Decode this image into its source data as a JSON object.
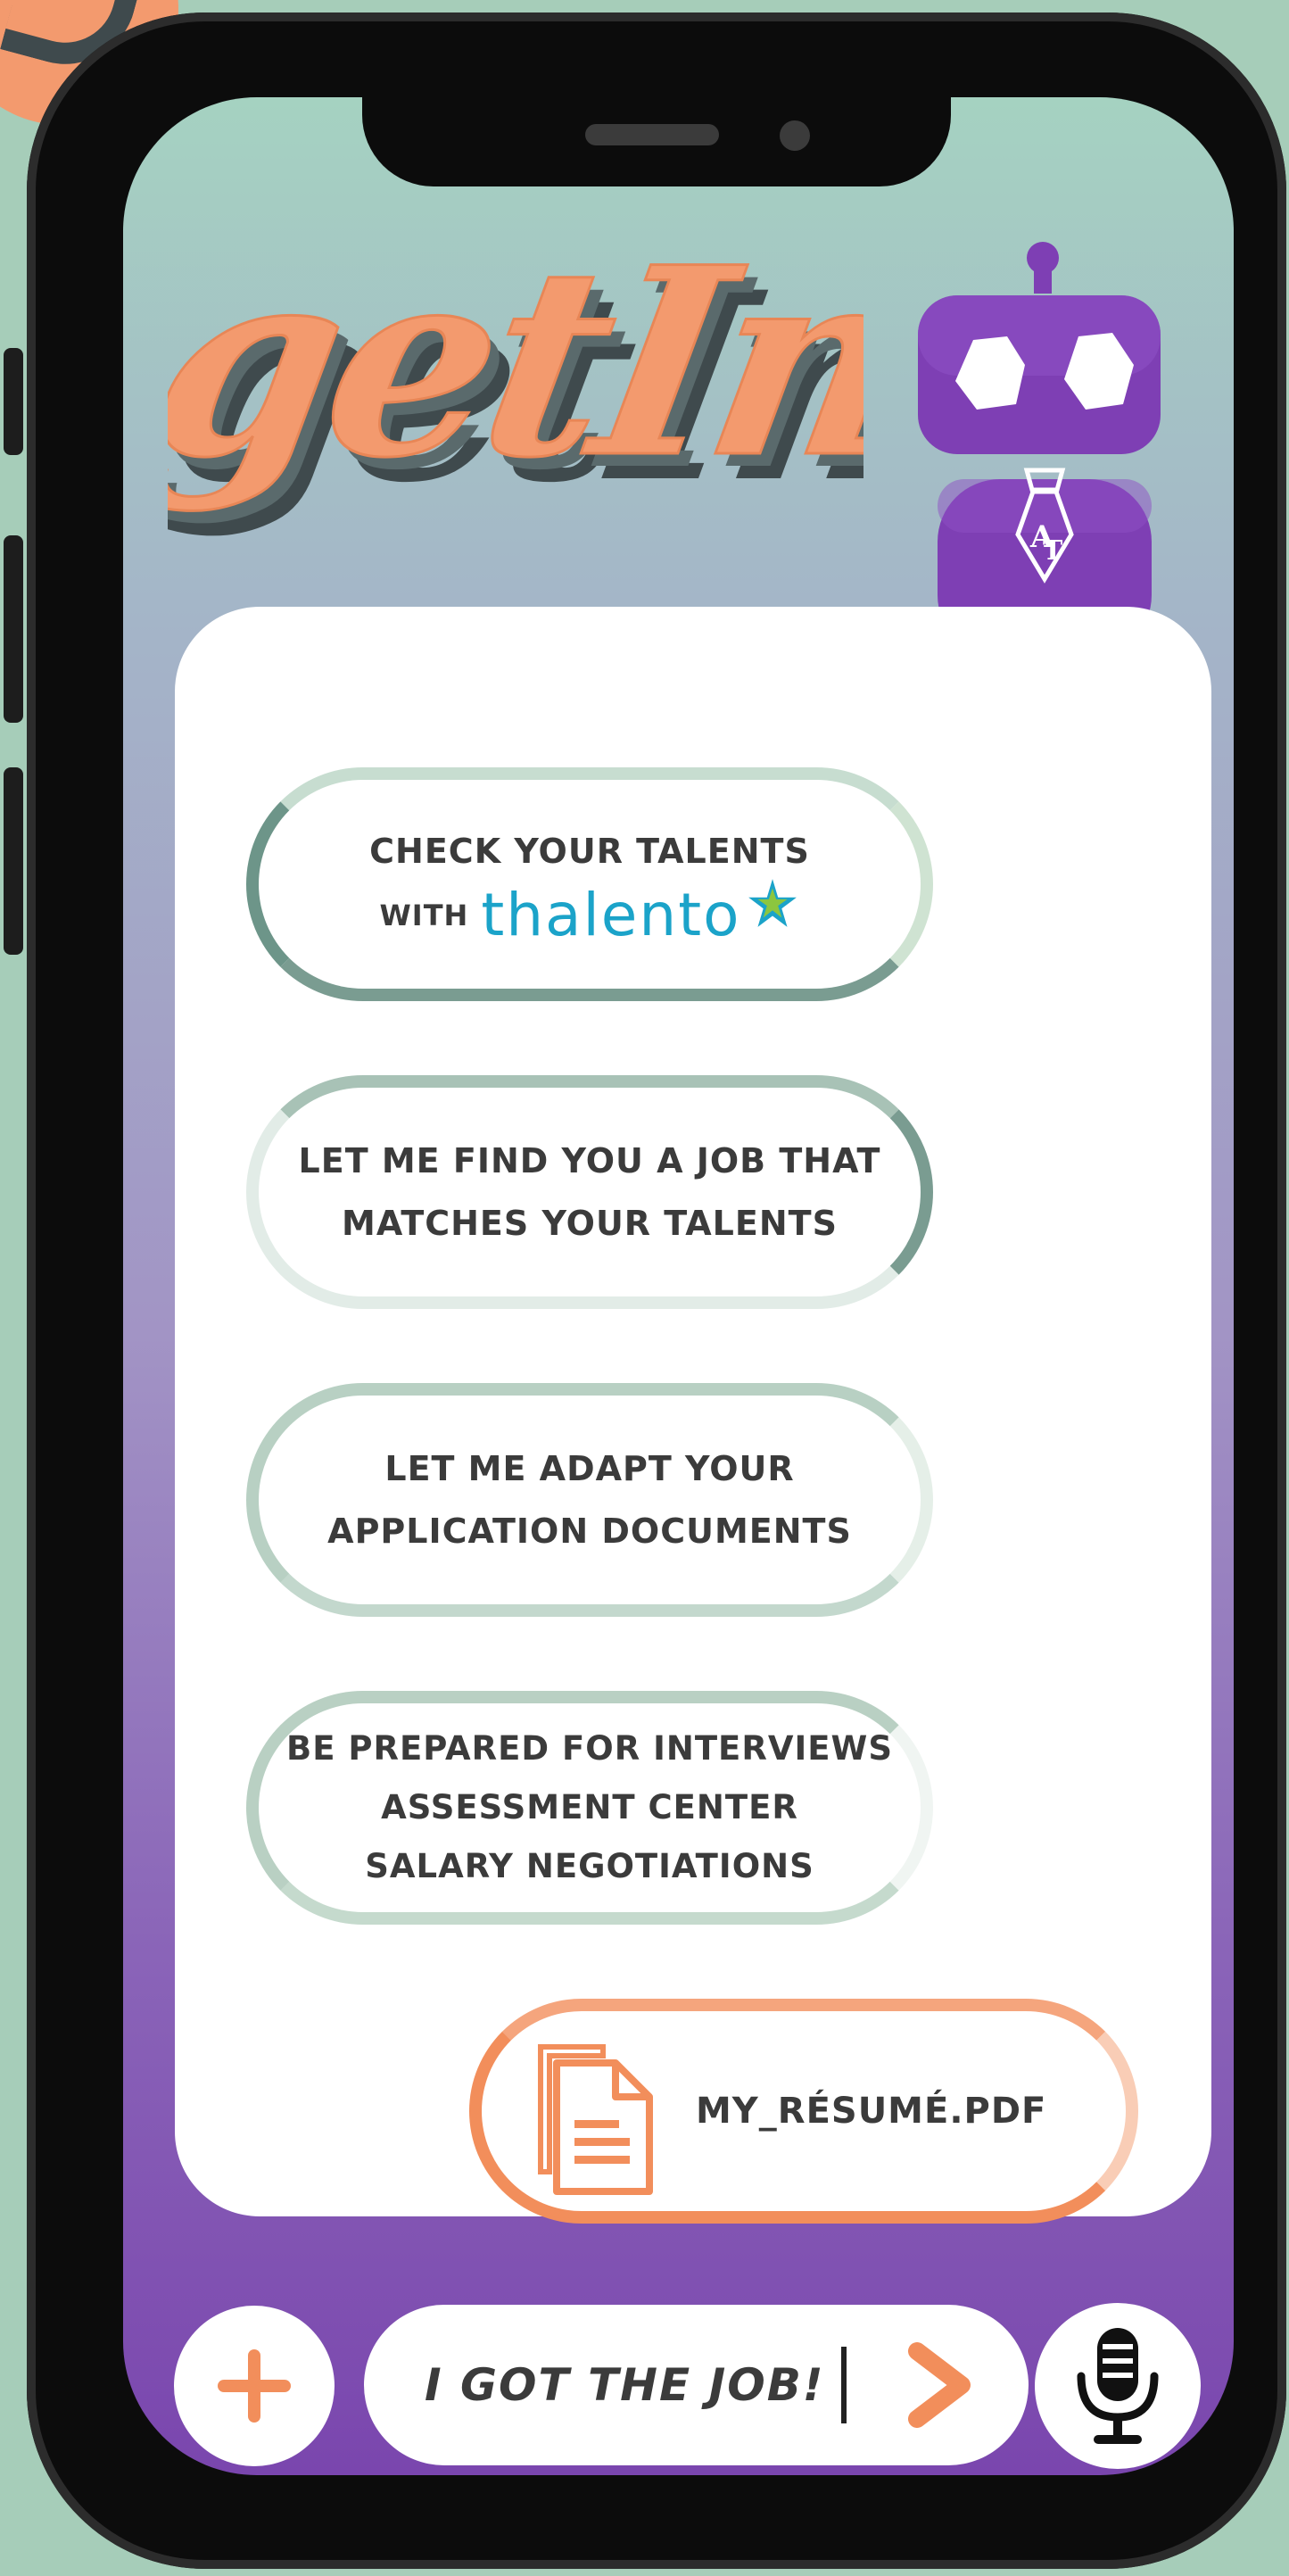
{
  "app": {
    "logo_text": "getIn"
  },
  "options": [
    {
      "lines": [
        "CHECK YOUR TALENTS"
      ],
      "with_label": "WITH",
      "brand": "thalento"
    },
    {
      "lines": [
        "LET ME FIND YOU A JOB THAT",
        "MATCHES YOUR TALENTS"
      ]
    },
    {
      "lines": [
        "LET ME ADAPT YOUR",
        "APPLICATION DOCUMENTS"
      ]
    },
    {
      "lines": [
        "BE PREPARED FOR INTERVIEWS",
        "ASSESSMENT CENTER",
        "SALARY NEGOTIATIONS"
      ]
    }
  ],
  "attachment": {
    "file_name": "MY_RÉSUMÉ.PDF",
    "icon": "document-icon"
  },
  "composer": {
    "input_value": "I GOT THE JOB!",
    "add_icon": "plus-icon",
    "send_icon": "chevron-right-icon",
    "mic_icon": "microphone-icon"
  },
  "colors": {
    "accent_orange": "#f28e5b",
    "robot_purple": "#7e3fb4",
    "thalento_blue": "#1ba3c9",
    "text_dark": "#3b3b3b"
  }
}
